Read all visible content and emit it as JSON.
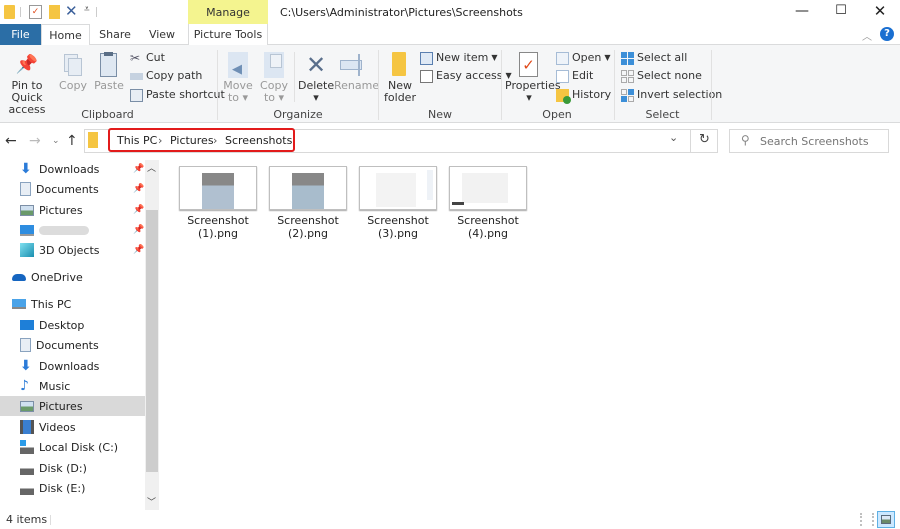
{
  "window": {
    "title_path": "C:\\Users\\Administrator\\Pictures\\Screenshots",
    "context_tab": "Manage",
    "controls": [
      "minimize",
      "maximize",
      "close"
    ]
  },
  "tabs": [
    {
      "label": "File",
      "active": false
    },
    {
      "label": "Home",
      "active": true
    },
    {
      "label": "Share",
      "active": false
    },
    {
      "label": "View",
      "active": false
    },
    {
      "label": "Picture Tools",
      "active": false
    }
  ],
  "ribbon": {
    "clipboard": {
      "group": "Clipboard",
      "pin": "Pin to Quick access",
      "pin_l1": "Pin to Quick",
      "pin_l2": "access",
      "copy": "Copy",
      "paste": "Paste",
      "cut": "Cut",
      "copy_path": "Copy path",
      "paste_shortcut": "Paste shortcut"
    },
    "organize": {
      "group": "Organize",
      "move_l1": "Move",
      "move_l2": "to",
      "copy_l1": "Copy",
      "copy_l2": "to",
      "delete": "Delete",
      "rename": "Rename"
    },
    "new": {
      "group": "New",
      "new_folder_l1": "New",
      "new_folder_l2": "folder",
      "new_item": "New item",
      "easy_access": "Easy access"
    },
    "open": {
      "group": "Open",
      "properties": "Properties",
      "open": "Open",
      "edit": "Edit",
      "history": "History"
    },
    "select": {
      "group": "Select",
      "select_all": "Select all",
      "select_none": "Select none",
      "invert": "Invert selection"
    }
  },
  "address": {
    "breadcrumbs": [
      "This PC",
      "Pictures",
      "Screenshots"
    ],
    "separator": "›",
    "search_placeholder": "Search Screenshots"
  },
  "sidebar": {
    "quick_access": [
      {
        "label": "Downloads",
        "icon": "download-icon",
        "pinned": true
      },
      {
        "label": "Documents",
        "icon": "document-icon",
        "pinned": true
      },
      {
        "label": "Pictures",
        "icon": "pictures-icon",
        "pinned": true
      },
      {
        "label": "",
        "icon": "desktop-icon",
        "pinned": true,
        "blurred": true
      },
      {
        "label": "3D Objects",
        "icon": "3d-objects-icon",
        "pinned": true
      }
    ],
    "onedrive": "OneDrive",
    "this_pc": "This PC",
    "this_pc_items": [
      {
        "label": "Desktop",
        "icon": "desktop-icon"
      },
      {
        "label": "Documents",
        "icon": "document-icon"
      },
      {
        "label": "Downloads",
        "icon": "download-icon"
      },
      {
        "label": "Music",
        "icon": "music-icon"
      },
      {
        "label": "Pictures",
        "icon": "pictures-icon",
        "selected": true
      },
      {
        "label": "Videos",
        "icon": "videos-icon"
      },
      {
        "label": "Local Disk (C:)",
        "icon": "local-disk-icon"
      },
      {
        "label": "Disk (D:)",
        "icon": "disk-icon"
      },
      {
        "label": "Disk (E:)",
        "icon": "disk-icon"
      }
    ]
  },
  "files": [
    {
      "line1": "Screenshot",
      "line2": "(1).png"
    },
    {
      "line1": "Screenshot",
      "line2": "(2).png"
    },
    {
      "line1": "Screenshot",
      "line2": "(3).png"
    },
    {
      "line1": "Screenshot",
      "line2": "(4).png"
    }
  ],
  "status": {
    "item_count": "4 items",
    "view_mode": "large-icons"
  },
  "colors": {
    "file_tab": "#2b6ea6",
    "manage_tab": "#f4f48f",
    "highlight_box": "#e21b1b",
    "selection": "#d9d9d9"
  }
}
